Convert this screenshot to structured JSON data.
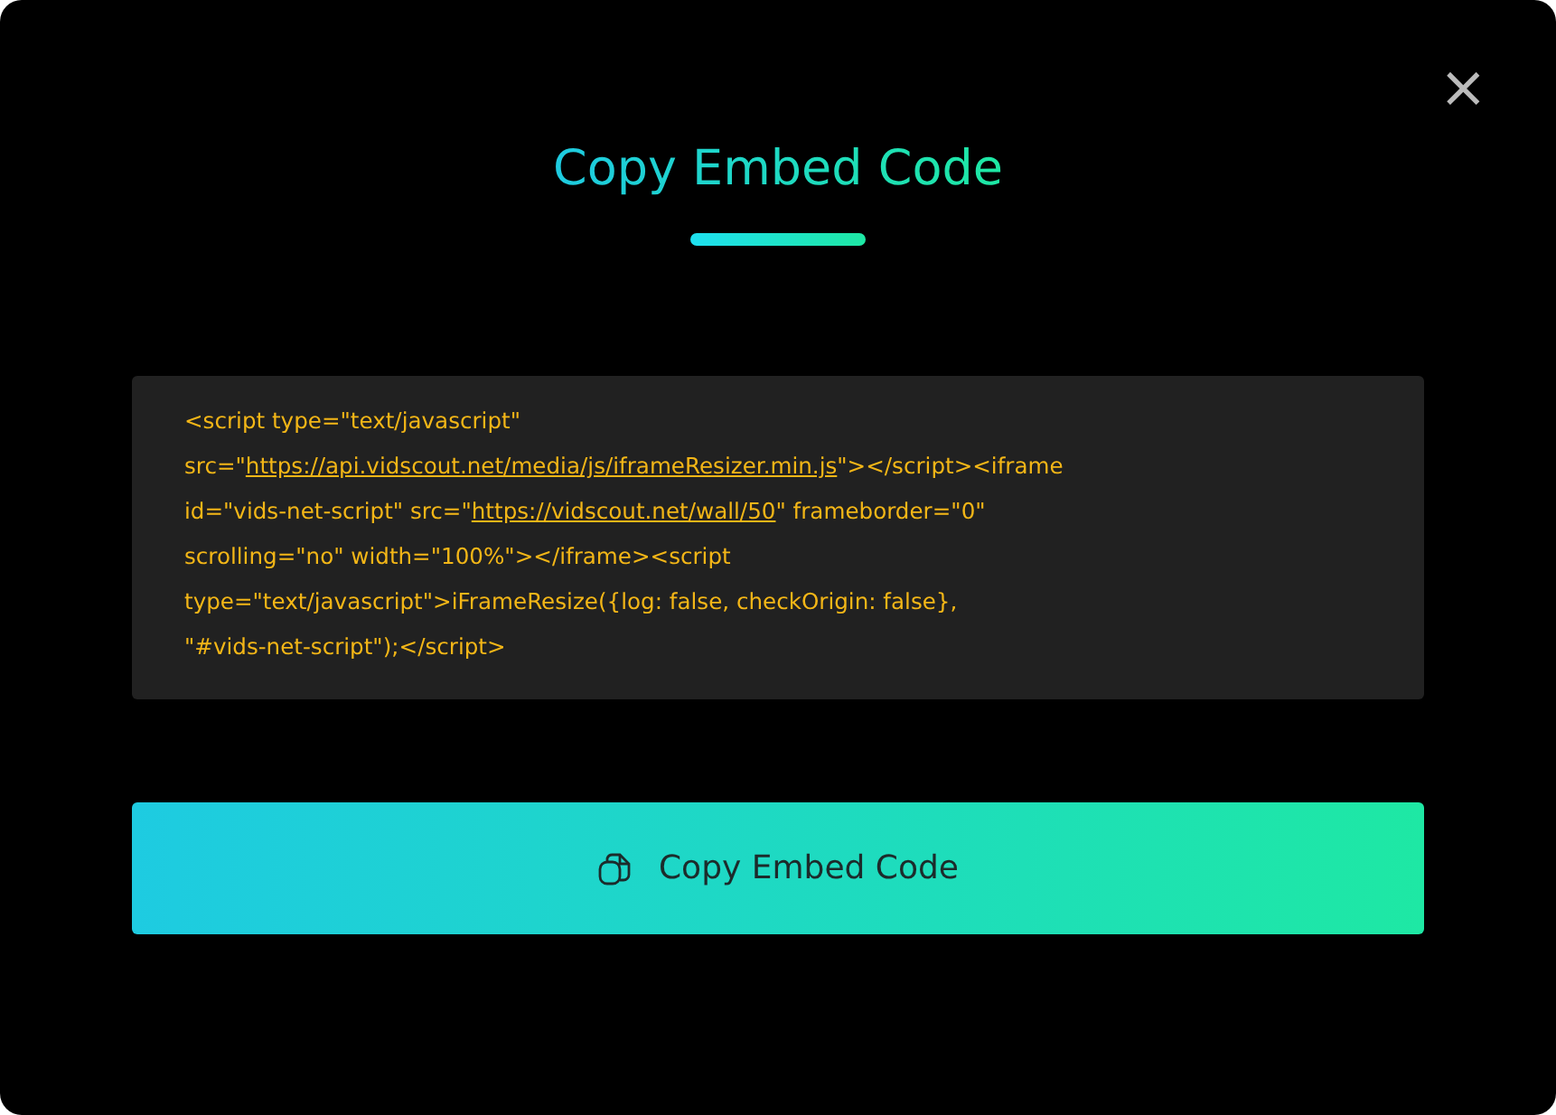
{
  "dialog": {
    "title": "Copy Embed Code",
    "close": "×"
  },
  "code_lines": [
    [
      {
        "kind": "plain",
        "text": "<script type=\"text/javascript\""
      }
    ],
    [
      {
        "kind": "plain",
        "text": "src=\""
      },
      {
        "kind": "link",
        "text": "https://api.vidscout.net/media/js/iframeResizer.min.js"
      },
      {
        "kind": "plain",
        "text": "\"></script><iframe"
      }
    ],
    [
      {
        "kind": "plain",
        "text": "id=\"vids-net-script\" src=\""
      },
      {
        "kind": "link",
        "text": "https://vidscout.net/wall/50"
      },
      {
        "kind": "plain",
        "text": "\" frameborder=\"0\""
      }
    ],
    [
      {
        "kind": "plain",
        "text": "scrolling=\"no\" width=\"100%\"></iframe><script"
      }
    ],
    [
      {
        "kind": "plain",
        "text": "type=\"text/javascript\">iFrameResize({log: false, checkOrigin: false},"
      }
    ],
    [
      {
        "kind": "plain",
        "text": "\"#vids-net-script\");</script>"
      }
    ]
  ],
  "button": {
    "label": "Copy Embed Code"
  }
}
